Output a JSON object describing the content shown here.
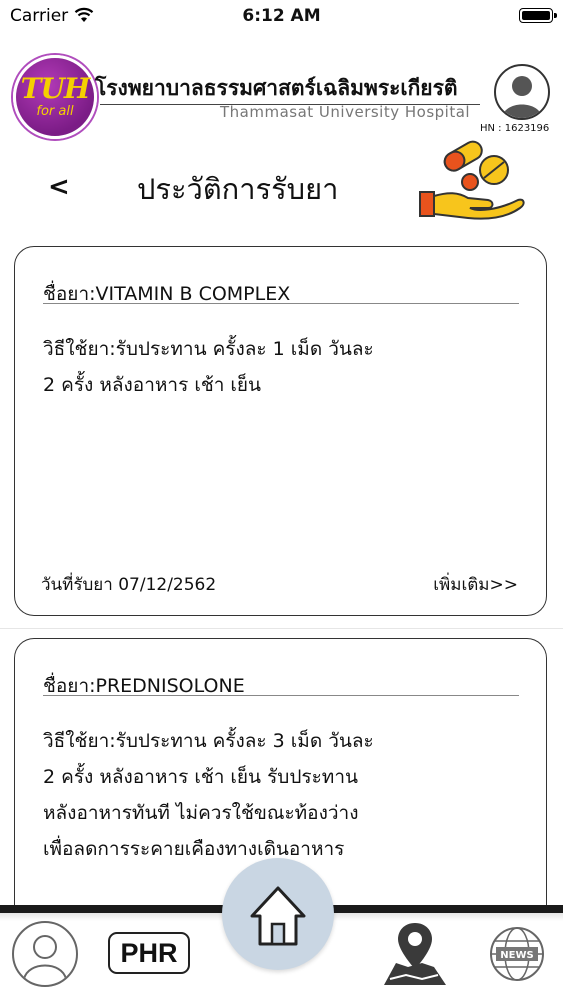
{
  "status_bar": {
    "carrier": "Carrier",
    "time": "6:12 AM"
  },
  "header": {
    "logo_text": "TUH",
    "logo_sub": "for all",
    "hospital_name_th": "โรงพยาบาลธรรมศาสตร์เฉลิมพระเกียรติ",
    "hospital_name_en": "Thammasat University Hospital",
    "hn": "HN : 1623196"
  },
  "page": {
    "back_label": "<",
    "title": "ประวัติการรับยา"
  },
  "records": [
    {
      "drug": "ชื่อยา:VITAMIN B COMPLEX",
      "usage_lines": [
        "วิธีใช้ยา:รับประทาน ครั้งละ 1 เม็ด วันละ",
        "2 ครั้ง หลังอาหาร เช้า เย็น"
      ],
      "date": "วันที่รับยา 07/12/2562",
      "more": "เพิ่มเติม>>"
    },
    {
      "drug": "ชื่อยา:PREDNISOLONE",
      "usage_lines": [
        "วิธีใช้ยา:รับประทาน ครั้งละ 3 เม็ด วันละ",
        "2 ครั้ง หลังอาหาร เช้า เย็น รับประทาน",
        "หลังอาหารทันที ไม่ควรใช้ขณะท้องว่าง",
        "เพื่อลดการระคายเคืองทางเดินอาหาร"
      ]
    }
  ],
  "tabbar": {
    "phr_label": "PHR",
    "news_label": "NEWS"
  },
  "icons": [
    "wifi-icon",
    "battery-icon",
    "profile-icon",
    "medicine-icon",
    "home-icon",
    "map-icon",
    "news-icon"
  ],
  "colors": {
    "logo_purple": "#8a2596",
    "logo_yellow": "#f5d000",
    "pill_yellow": "#f7c51c",
    "pill_orange": "#e8531d",
    "home_circle": "#c9d6e3"
  }
}
